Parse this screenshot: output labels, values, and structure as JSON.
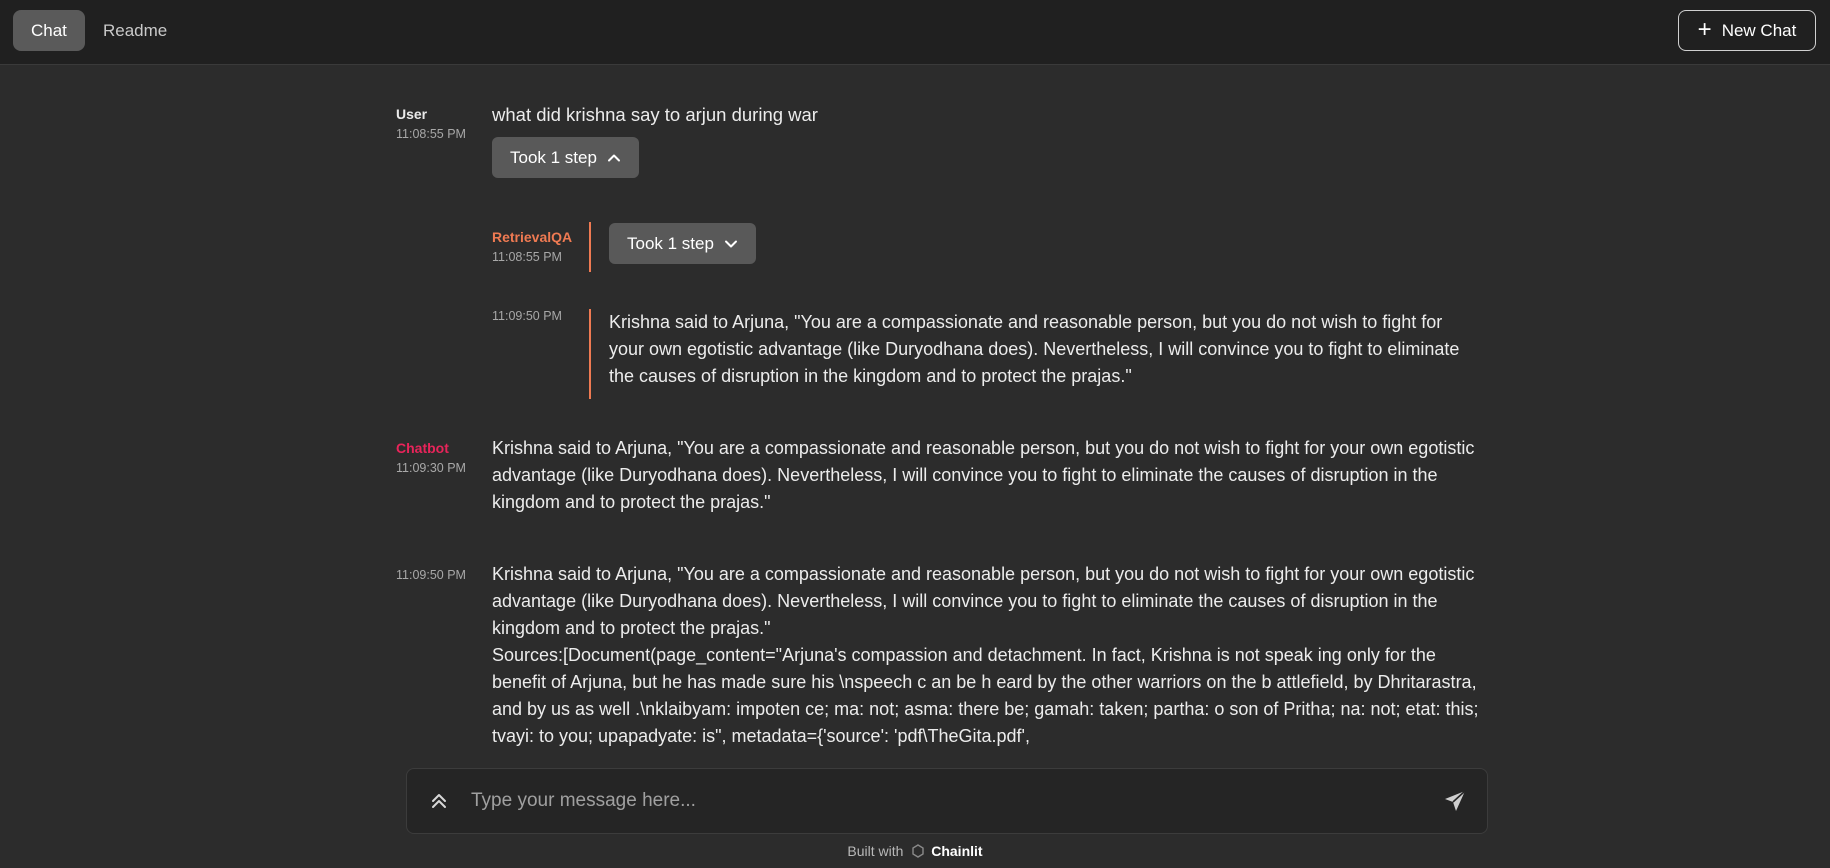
{
  "nav": {
    "tabs": [
      {
        "label": "Chat",
        "active": true
      },
      {
        "label": "Readme",
        "active": false
      }
    ],
    "new_chat_label": "New Chat"
  },
  "messages": {
    "user": {
      "author": "User",
      "time": "11:08:55 PM",
      "text": "what did krishna say to arjun during war",
      "steps_label": "Took 1 step",
      "steps_state": "expanded"
    },
    "retrieval": {
      "author": "RetrievalQA",
      "time": "11:08:55 PM",
      "steps_label": "Took 1 step",
      "steps_state": "collapsed"
    },
    "retrieval_output": {
      "time": "11:09:50 PM",
      "text": "Krishna said to Arjuna, \"You are a compassionate and reasonable person, but you do not wish to fight for your own egotistic advantage (like Duryodhana does). Nevertheless, I will convince you to fight to eliminate the causes of disruption in the kingdom and to protect the prajas.\""
    },
    "chatbot": {
      "author": "Chatbot",
      "time": "11:09:30 PM",
      "text": "Krishna said to Arjuna, \"You are a compassionate and reasonable person, but you do not wish to fight for your own egotistic advantage (like Duryodhana does). Nevertheless, I will convince you to fight to eliminate the causes of disruption in the kingdom and to protect the prajas.\""
    },
    "final": {
      "time": "11:09:50 PM",
      "text": "Krishna said to Arjuna, \"You are a compassionate and reasonable person, but you do not wish to fight for your own egotistic advantage (like Duryodhana does). Nevertheless, I will convince you to fight to eliminate the causes of disruption in the kingdom and to protect the prajas.\"",
      "sources": "Sources:[Document(page_content=\"Arjuna's  compassion  and detachment.  In fact, Krishna  is not speak ing only for the benefit  of Arjuna,  but he has made sure his \\nspeech c an be h eard by the other warriors  on the b attlefield, by Dhritarastra, and by us as well .\\nklaibyam:  impoten ce; ma: not; asma: there  be; gamah: taken; partha: o son of Pritha;  na: not; etat: this; tvayi:  to you; upapadyate:  is\", metadata={'source': 'pdf\\TheGita.pdf',"
    }
  },
  "composer": {
    "placeholder": "Type your message here..."
  },
  "footer": {
    "prefix": "Built with",
    "brand": "Chainlit"
  },
  "colors": {
    "background": "#2c2c2c",
    "header": "#202020",
    "retrieval_accent": "#ef7a52",
    "chatbot_accent": "#e8245a"
  }
}
